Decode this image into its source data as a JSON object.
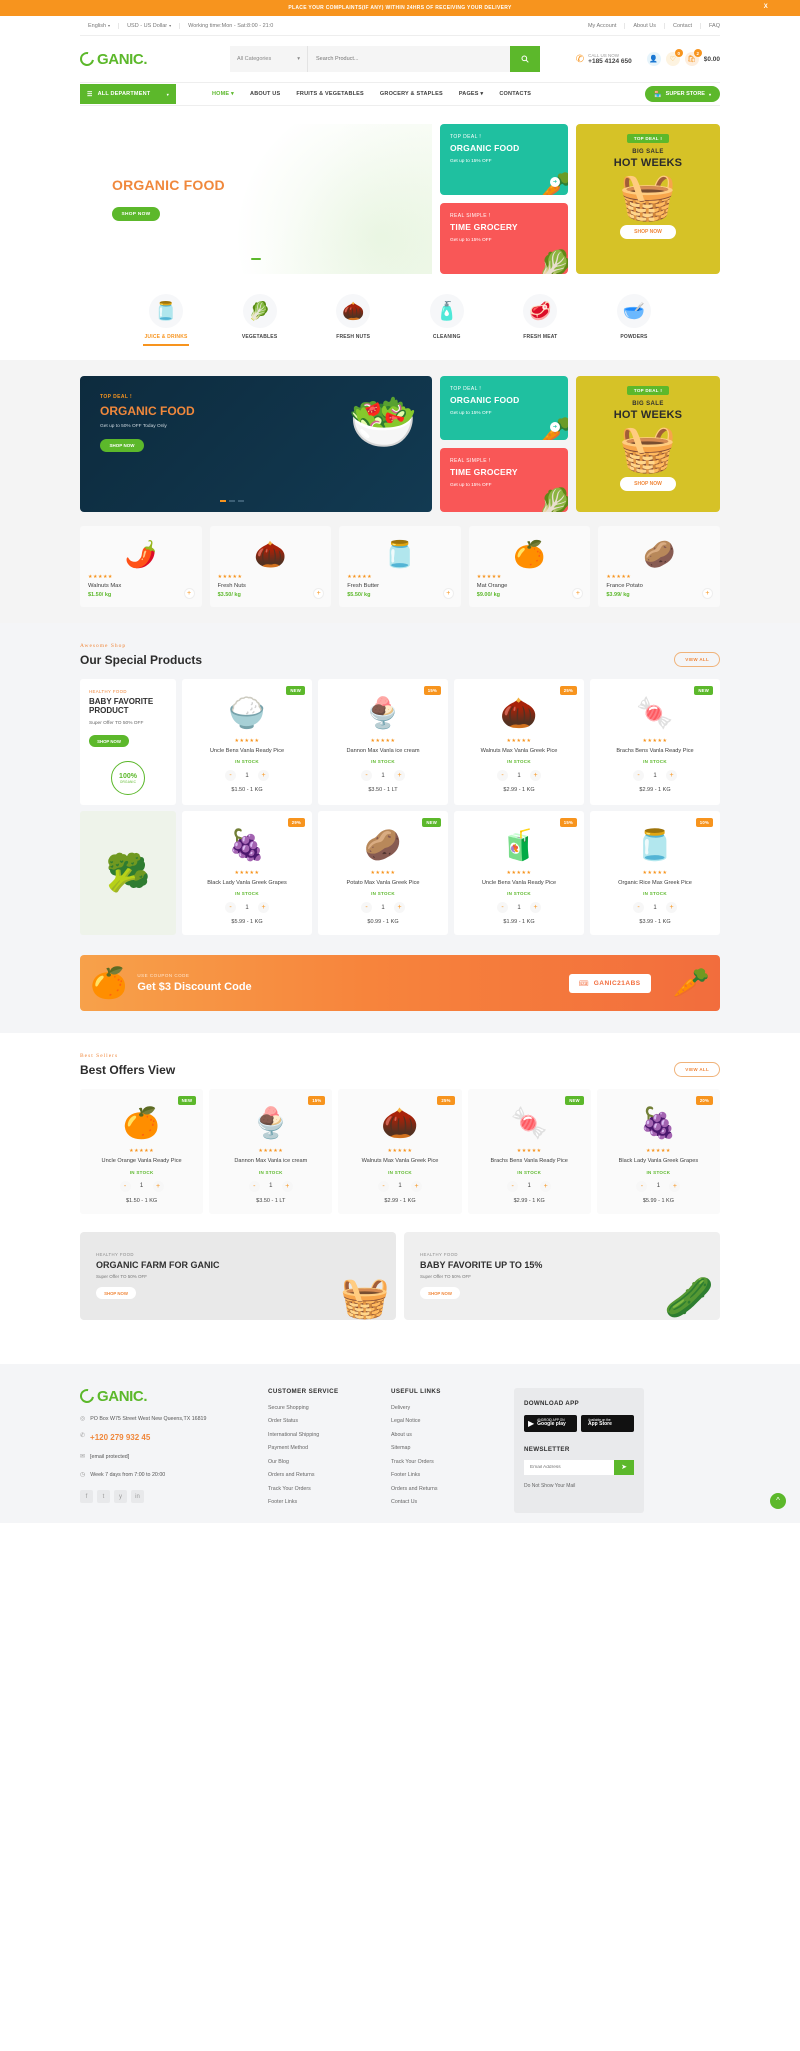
{
  "announcement": {
    "text": "PLACE YOUR COMPLAINTS(IF ANY) WITHIN 24HRS OF RECEIVING YOUR DELIVERY",
    "close": "X"
  },
  "topbar": {
    "language": "English",
    "currency": "USD - US Dollar",
    "working_time": "Working time:Mon - Sat:8:00 - 21:0",
    "links": [
      "My Account",
      "About Us",
      "Contact",
      "FAQ"
    ]
  },
  "header": {
    "logo_text": "GANIC.",
    "category_select": "All Categories",
    "search_placeholder": "Search Product...",
    "call_label": "CALL US NOW",
    "phone": "+185 4124 650",
    "wishlist_count": "0",
    "cart_count": "2",
    "cart_total": "$0.00"
  },
  "nav": {
    "all_department": "ALL DEPARTMENT",
    "links": [
      "HOME",
      "ABOUT US",
      "FRUITS & VEGETABLES",
      "GROCERY & STAPLES",
      "PAGES",
      "CONTACTS"
    ],
    "active": "HOME",
    "super_store": "SUPER STORE"
  },
  "hero": {
    "title": "ORGANIC FOOD",
    "shop_now": "SHOP NOW",
    "promo_teal": {
      "kicker": "TOP DEAL !",
      "title": "ORGANIC FOOD",
      "sub": "Get up to 15% OFF"
    },
    "promo_red": {
      "kicker": "REAL SIMPLE !",
      "title": "TIME GROCERY",
      "sub": "Get up to 15% OFF"
    },
    "promo_yellow": {
      "pill": "TOP DEAL !",
      "small": "BIG SALE",
      "big": "HOT WEEKS",
      "button": "SHOP NOW"
    }
  },
  "categories": [
    {
      "label": "JUICE & DRINKS",
      "icon": "juice-jar-icon",
      "glyph": "🫙",
      "active": true
    },
    {
      "label": "VEGETABLES",
      "icon": "vegetables-icon",
      "glyph": "🥦"
    },
    {
      "label": "FRESH NUTS",
      "icon": "nuts-icon",
      "glyph": "🌰"
    },
    {
      "label": "CLEANING",
      "icon": "cleaning-icon",
      "glyph": "🧴"
    },
    {
      "label": "FRESH MEAT",
      "icon": "meat-icon",
      "glyph": "🥩"
    },
    {
      "label": "POWDERS",
      "icon": "powders-icon",
      "glyph": "🥣"
    }
  ],
  "strip_banner": {
    "kicker": "TOP DEAL !",
    "title": "ORGANIC FOOD",
    "sub": "Get up to 50% OFF Today Only",
    "button": "SHOP NOW"
  },
  "strip_products": [
    {
      "name": "Walnuts Max",
      "price": "$1.50/ kg",
      "stars": "★★★★★",
      "glyph": "🌶️"
    },
    {
      "name": "Fresh Nuts",
      "price": "$3.50/ kg",
      "stars": "★★★★★",
      "glyph": "🌰"
    },
    {
      "name": "Fresh Butter",
      "price": "$5.50/ kg",
      "stars": "★★★★★",
      "glyph": "🫙"
    },
    {
      "name": "Mat Orange",
      "price": "$9.00/ kg",
      "stars": "★★★★★",
      "glyph": "🍊"
    },
    {
      "name": "France Potato",
      "price": "$3.99/ kg",
      "stars": "★★★★★",
      "glyph": "🥔"
    }
  ],
  "special": {
    "kicker": "Awesome  Shop",
    "title": "Our Special Products",
    "view_all": "VIEW ALL",
    "promo": {
      "kicker": "HEALTHY FOOD",
      "title": "BABY FAVORITE PRODUCT",
      "sub": "Super Offer TO 50% OFF",
      "button": "SHOP NOW",
      "seal_number": "100%",
      "seal_text": "ORGANIC"
    },
    "products": [
      {
        "name": "Uncle Bens Vanla Ready Pice",
        "stock": "IN STOCK",
        "qty": "1",
        "price": "$1.50 - 1 KG",
        "tag": "NEW",
        "tag_type": "new",
        "stars": "★★★★★",
        "glyph": "🍚"
      },
      {
        "name": "Dannon Max Vanla ice cream",
        "stock": "IN STOCK",
        "qty": "1",
        "price": "$3.50 - 1 LT",
        "tag": "15%",
        "tag_type": "off",
        "stars": "★★★★★",
        "glyph": "🍨"
      },
      {
        "name": "Walnuts Max Vanla Greek Pice",
        "stock": "IN STOCK",
        "qty": "1",
        "price": "$2.99 - 1 KG",
        "tag": "25%",
        "tag_type": "off",
        "stars": "★★★★★",
        "glyph": "🌰"
      },
      {
        "name": "Brachs Bens Vanla Ready Pice",
        "stock": "IN STOCK",
        "qty": "1",
        "price": "$2.99 - 1 KG",
        "tag": "NEW",
        "tag_type": "new",
        "stars": "★★★★★",
        "glyph": "🍬"
      },
      {
        "name": "Black Lady Vanla Greek Grapes",
        "stock": "IN STOCK",
        "qty": "1",
        "price": "$5.99 - 1 KG",
        "tag": "29%",
        "tag_type": "off",
        "stars": "★★★★★",
        "glyph": "🍇"
      },
      {
        "name": "Potato Max Vanla Greek Pice",
        "stock": "IN STOCK",
        "qty": "1",
        "price": "$0.99 - 1 KG",
        "tag": "NEW",
        "tag_type": "new",
        "stars": "★★★★★",
        "glyph": "🥔"
      },
      {
        "name": "Uncle Bens Vanla Ready Pice",
        "stock": "IN STOCK",
        "qty": "1",
        "price": "$1.99 - 1 KG",
        "tag": "15%",
        "tag_type": "off",
        "stars": "★★★★★",
        "glyph": "🧃"
      },
      {
        "name": "Organic Rice Max Greek Pice",
        "stock": "IN STOCK",
        "qty": "1",
        "price": "$3.99 - 1 KG",
        "tag": "10%",
        "tag_type": "off",
        "stars": "★★★★★",
        "glyph": "🫙"
      }
    ]
  },
  "coupon": {
    "kicker": "USE COUPON CODE",
    "title": "Get $3 Discount Code",
    "code": "GANIC21ABS"
  },
  "best": {
    "kicker": "Best Sellers",
    "title": "Best Offers View",
    "view_all": "VIEW ALL",
    "products": [
      {
        "name": "Uncle Orange Vanla Ready Pice",
        "stock": "IN STOCK",
        "qty": "1",
        "price": "$1.50 - 1 KG",
        "tag": "NEW",
        "tag_type": "new",
        "stars": "★★★★★",
        "glyph": "🍊"
      },
      {
        "name": "Dannon Max Vanla ice cream",
        "stock": "IN STOCK",
        "qty": "1",
        "price": "$3.50 - 1 LT",
        "tag": "15%",
        "tag_type": "off",
        "stars": "★★★★★",
        "glyph": "🍨"
      },
      {
        "name": "Walnuts Max Vanla Greek Pice",
        "stock": "IN STOCK",
        "qty": "1",
        "price": "$2.99 - 1 KG",
        "tag": "25%",
        "tag_type": "off",
        "stars": "★★★★★",
        "glyph": "🌰"
      },
      {
        "name": "Brachs Bens Vanla Ready Pice",
        "stock": "IN STOCK",
        "qty": "1",
        "price": "$2.99 - 1 KG",
        "tag": "NEW",
        "tag_type": "new",
        "stars": "★★★★★",
        "glyph": "🍬"
      },
      {
        "name": "Black Lady Vanla Greek Grapes",
        "stock": "IN STOCK",
        "qty": "1",
        "price": "$5.99 - 1 KG",
        "tag": "20%",
        "tag_type": "off",
        "stars": "★★★★★",
        "glyph": "🍇"
      }
    ]
  },
  "bottom_banners": [
    {
      "kicker": "HEALTHY FOOD",
      "title": "ORGANIC FARM FOR GANIC",
      "sub": "Super Offer TO 50% OFF",
      "button": "SHOP NOW",
      "glyph": "🧺"
    },
    {
      "kicker": "HEALTHY FOOD",
      "title": "BABY FAVORITE UP TO 15%",
      "sub": "Super Offer TO 50% OFF",
      "button": "SHOP NOW",
      "glyph": "🥬"
    }
  ],
  "footer": {
    "logo_text": "GANIC.",
    "address": "PO Box W75 Street West New Queens,TX 16819",
    "phone": "+120 279 932 45",
    "email": "[email protected]",
    "hours": "Week 7 days from 7:00 to 20:00",
    "social": [
      "f",
      "t",
      "y",
      "in"
    ],
    "customer_service": {
      "title": "CUSTOMER SERVICE",
      "links": [
        "Secure Shopping",
        "Order Status",
        "International Shipping",
        "Payment Method",
        "Our Blog",
        "Orders and Returns",
        "Track Your Orders",
        "Footer Links"
      ]
    },
    "useful_links": {
      "title": "USEFUL LINKS",
      "links": [
        "Delivery",
        "Legal Notice",
        "About us",
        "Sitemap",
        "Track Your Orders",
        "Footer Links",
        "Orders and Returns",
        "Contact Us"
      ]
    },
    "app": {
      "title": "DOWNLOAD APP",
      "google_small": "ANDROID APP ON",
      "google_big": "Google play",
      "apple_small": "Available on the",
      "apple_big": "App Store",
      "newsletter_title": "NEWSLETTER",
      "email_placeholder": "Email Address",
      "note": "Do Not Show Your Mail"
    }
  }
}
